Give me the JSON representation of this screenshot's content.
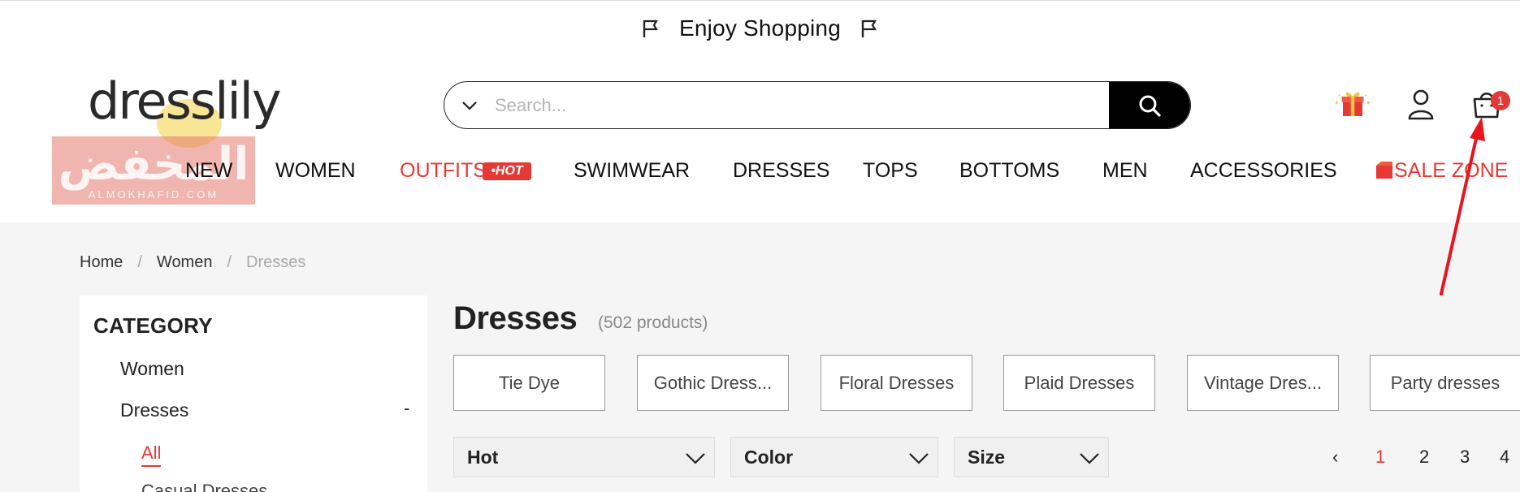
{
  "topbar": {
    "promo": "Enjoy Shopping"
  },
  "header": {
    "logo": "dresslily",
    "search_placeholder": "Search...",
    "cart_count": "1"
  },
  "watermark": {
    "arabic": "المخفض",
    "latin": "ALMOKHAFID.COM"
  },
  "nav": {
    "items": [
      "NEW",
      "WOMEN",
      "OUTFITS",
      "SWIMWEAR",
      "DRESSES",
      "TOPS",
      "BOTTOMS",
      "MEN",
      "ACCESSORIES",
      "SALE ZONE"
    ],
    "hot_tag": "•HOT"
  },
  "breadcrumb": [
    "Home",
    "Women",
    "Dresses"
  ],
  "sidebar": {
    "title": "CATEGORY",
    "level1": "Women",
    "level2": "Dresses",
    "collapse": "-",
    "active": "All",
    "next_item": "Casual Dresses"
  },
  "main": {
    "heading": "Dresses",
    "count": "(502 products)",
    "chips": [
      "Tie Dye",
      "Gothic Dress...",
      "Floral Dresses",
      "Plaid Dresses",
      "Vintage Dres...",
      "Party dresses"
    ],
    "filters": [
      "Hot",
      "Color",
      "Size"
    ],
    "pagination": {
      "prev": "‹",
      "pages": [
        "1",
        "2",
        "3",
        "4"
      ],
      "current": "1"
    }
  },
  "colors": {
    "accent": "#e53935",
    "content_bg": "#f5f5f5",
    "search_button": "#000000"
  },
  "icons": [
    "flag-icon",
    "chevron-down-icon",
    "search-icon",
    "gift-icon",
    "user-icon",
    "cart-icon",
    "sale-icon",
    "annotation-arrow"
  ]
}
